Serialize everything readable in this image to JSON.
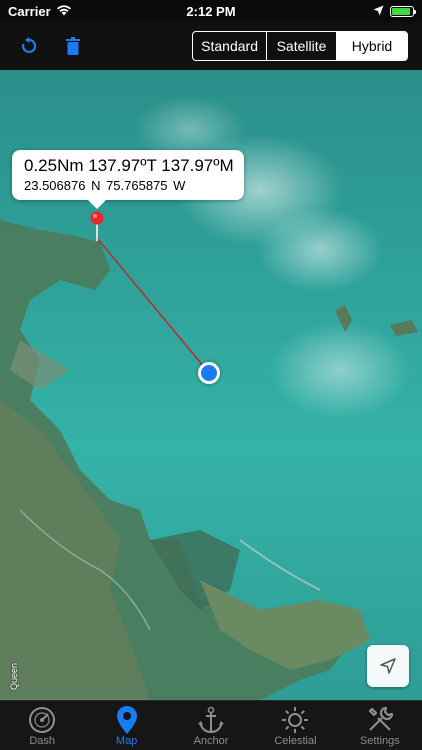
{
  "status_bar": {
    "carrier": "Carrier",
    "time": "2:12 PM",
    "battery_level": 0.9,
    "icons": [
      "wifi-icon",
      "location-arrow-icon",
      "battery-icon"
    ]
  },
  "toolbar": {
    "icons": [
      "refresh-icon",
      "trash-icon"
    ],
    "map_types": [
      "Standard",
      "Satellite",
      "Hybrid"
    ],
    "selected_map_type": "Hybrid"
  },
  "map": {
    "callout_title": "0.25Nm 137.97ºT 137.97ºM",
    "callout_sub": "23.506876 N   75.765875 W",
    "legal_label": "Queen",
    "pin_color": "#e8282b",
    "user_color": "#1a7cf2",
    "line_color": "#c0282b"
  },
  "tabs": [
    {
      "label": "Dash",
      "icon": "gauge-icon"
    },
    {
      "label": "Map",
      "icon": "map-pin-icon"
    },
    {
      "label": "Anchor",
      "icon": "anchor-icon"
    },
    {
      "label": "Celestial",
      "icon": "sun-icon"
    },
    {
      "label": "Settings",
      "icon": "wrench-screwdriver-icon"
    }
  ],
  "active_tab": "Map"
}
